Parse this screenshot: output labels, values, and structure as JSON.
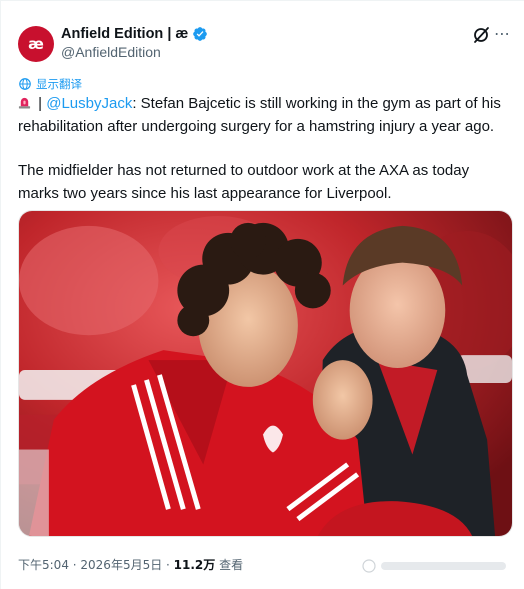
{
  "account": {
    "display_name": "Anfield Edition | æ",
    "handle": "@AnfieldEdition",
    "avatar_text": "æ",
    "avatar_color": "#c8102e"
  },
  "translate_label": "显示翻译",
  "tweet": {
    "mention": "@LusbyJack",
    "separator": " | ",
    "line1_rest": ": Stefan Bajcetic is still working in the gym as part of his rehabilitation after undergoing surgery for a hamstring injury a year ago.",
    "line2": "The midfielder has not returned to outdoor work at the AXA as today marks two years since his last appearance for Liverpool."
  },
  "meta": {
    "time": "下午5:04",
    "dot": " · ",
    "date": "2026年5月5日",
    "views_count": "11.2万",
    "views_label": " 查看"
  },
  "icons": {
    "verified": "verified-badge-icon",
    "grok": "grok-icon",
    "more": "more-options-icon",
    "translate": "translate-globe-icon",
    "siren": "police-siren-emoji-icon"
  },
  "colors": {
    "accent": "#1d9bf0",
    "text": "#0f1419",
    "muted": "#536471",
    "brand": "#c8102e"
  }
}
